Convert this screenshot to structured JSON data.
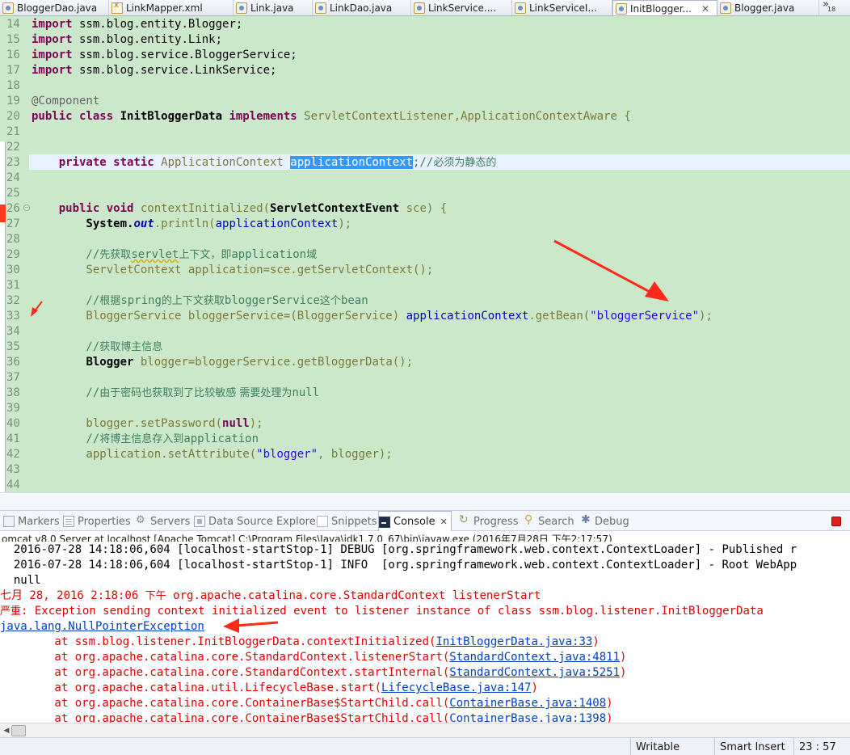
{
  "tabs": [
    {
      "label": "BloggerDao.java",
      "icon": "java-file-icon",
      "active": false
    },
    {
      "label": "LinkMapper.xml",
      "icon": "xml-file-icon",
      "active": false
    },
    {
      "label": "Link.java",
      "icon": "java-file-icon",
      "active": false
    },
    {
      "label": "LinkDao.java",
      "icon": "java-file-icon",
      "active": false
    },
    {
      "label": "LinkService....",
      "icon": "java-file-icon",
      "active": false
    },
    {
      "label": "LinkServiceI...",
      "icon": "java-file-icon",
      "active": false
    },
    {
      "label": "InitBlogger...",
      "icon": "java-file-icon",
      "active": true,
      "close": "✕"
    },
    {
      "label": "Blogger.java",
      "icon": "java-file-icon",
      "active": false
    }
  ],
  "tab_overflow": {
    "symbol": "»",
    "count": "18"
  },
  "editor": {
    "line_numbers": [
      "14",
      "15",
      "16",
      "17",
      "18",
      "19",
      "20",
      "21",
      "22",
      "23",
      "24",
      "25",
      "26",
      "27",
      "28",
      "29",
      "30",
      "31",
      "32",
      "33",
      "34",
      "35",
      "36",
      "37",
      "38",
      "39",
      "40",
      "41",
      "42",
      "43",
      "44"
    ],
    "lines": {
      "l14": [
        "import",
        " ssm.blog.entity.Blogger;"
      ],
      "l15": [
        "import",
        " ssm.blog.entity.Link;"
      ],
      "l16": [
        "import",
        " ssm.blog.service.BloggerService;"
      ],
      "l17": [
        "import",
        " ssm.blog.service.LinkService;"
      ],
      "l19": "@Component",
      "l20": [
        "public class",
        " InitBloggerData ",
        "implements",
        " ServletContextListener,ApplicationContextAware {"
      ],
      "l23": [
        "    private static",
        " ApplicationContext ",
        "applicationContext",
        ";//",
        "必须为静态的"
      ],
      "l26": [
        "    public void",
        " contextInitialized(",
        "ServletContextEvent",
        " sce) {"
      ],
      "l27": [
        "        System.",
        "out",
        ".println(",
        "applicationContext",
        ");"
      ],
      "l29": [
        "        //",
        "先获取",
        "servlet",
        "上下文，即",
        "application",
        "域"
      ],
      "l30": [
        "        ServletContext application=sce.getServletContext();"
      ],
      "l32": [
        "        //",
        "根据",
        "spring",
        "的上下文获取",
        "bloggerService",
        "这个",
        "bean"
      ],
      "l33": [
        "        BloggerService bloggerService=(BloggerService) ",
        "applicationContext",
        ".getBean(",
        "\"bloggerService\"",
        ");"
      ],
      "l35": [
        "        //",
        "获取博主信息"
      ],
      "l36": [
        "        ",
        "Blogger",
        " blogger=bloggerService.getBloggerData();"
      ],
      "l38": [
        "        //",
        "由于密码也获取到了比较敏感 需要处理为",
        "null"
      ],
      "l40": [
        "        blogger.setPassword(",
        "null",
        ");"
      ],
      "l41": [
        "        //",
        "将博主信息存入到",
        "application"
      ],
      "l42": [
        "        application.setAttribute(",
        "\"blogger\"",
        ", blogger);"
      ]
    }
  },
  "views": [
    {
      "label": "Markers",
      "icon": "markers-icon"
    },
    {
      "label": "Properties",
      "icon": "properties-icon"
    },
    {
      "label": "Servers",
      "icon": "servers-icon"
    },
    {
      "label": "Data Source Explorer",
      "icon": "data-source-icon"
    },
    {
      "label": "Snippets",
      "icon": "snippets-icon"
    },
    {
      "label": "Console",
      "icon": "console-icon",
      "active": true,
      "close": "✕"
    },
    {
      "label": "Progress",
      "icon": "progress-icon"
    },
    {
      "label": "Search",
      "icon": "search-icon"
    },
    {
      "label": "Debug",
      "icon": "debug-icon"
    }
  ],
  "console": {
    "title": "omcat v8.0 Server at localhost [Apache Tomcat] C:\\Program Files\\Java\\jdk1.7.0_67\\bin\\javaw.exe (2016年7月28日 下午2:17:57)",
    "lines": {
      "c1": "  2016-07-28 14:18:06,604 [localhost-startStop-1] DEBUG [org.springframework.web.context.ContextLoader] - Published r",
      "c2": "  2016-07-28 14:18:06,604 [localhost-startStop-1] INFO  [org.springframework.web.context.ContextLoader] - Root WebApp",
      "c3": "  null",
      "c4": [
        "七月 28, 2016 2:18:06 ",
        "下午",
        " org.apache.catalina.core.StandardContext listenerStart"
      ],
      "c5": [
        "严重",
        ": Exception sending context initialized event to listener instance of class ssm.blog.listener.InitBloggerData"
      ],
      "c6": "java.lang.NullPointerException",
      "c7": [
        "        at ssm.blog.listener.InitBloggerData.contextInitialized(",
        "InitBloggerData.java:33",
        ")"
      ],
      "c8": [
        "        at org.apache.catalina.core.StandardContext.listenerStart(",
        "StandardContext.java:4811",
        ")"
      ],
      "c9": [
        "        at org.apache.catalina.core.StandardContext.startInternal(",
        "StandardContext.java:5251",
        ")"
      ],
      "c10": [
        "        at org.apache.catalina.util.LifecycleBase.start(",
        "LifecycleBase.java:147",
        ")"
      ],
      "c11": [
        "        at org.apache.catalina.core.ContainerBase$StartChild.call(",
        "ContainerBase.java:1408",
        ")"
      ],
      "c12": [
        "        at org.apache.catalina.core.ContainerBase$StartChild.call(",
        "ContainerBase.java:1398",
        ")"
      ]
    }
  },
  "status": {
    "writable": "Writable",
    "insert_mode": "Smart Insert",
    "position": "23 : 57"
  },
  "colors": {
    "editor_bg": "#cbe8cb",
    "keyword": "#7f0055",
    "field": "#0000c0",
    "string": "#2a00ff",
    "comment": "#3f7f5f",
    "error": "#e00000",
    "annotation_arrow": "#ff2a1a"
  }
}
